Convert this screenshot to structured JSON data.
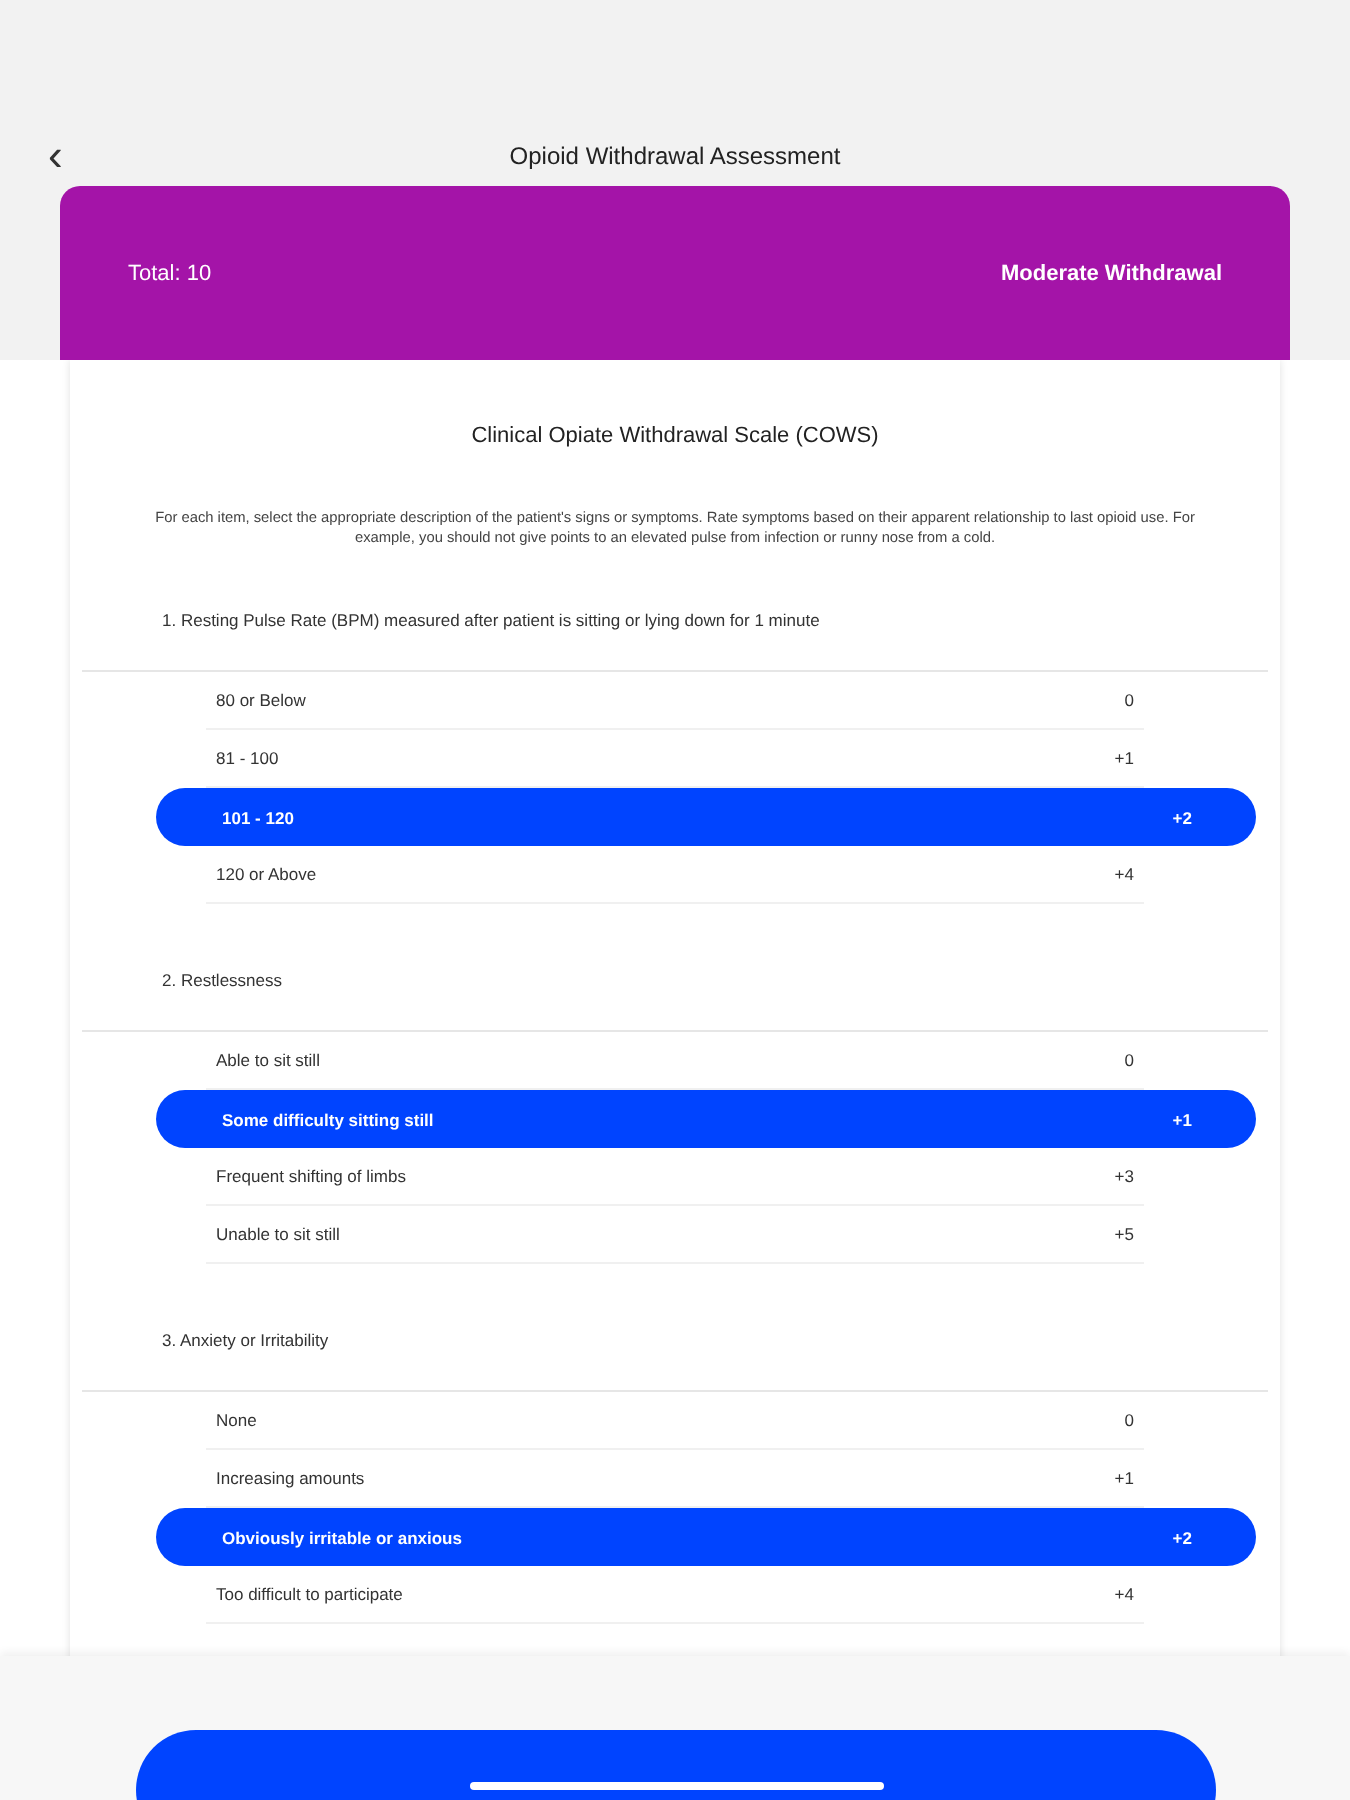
{
  "nav": {
    "back": "‹",
    "title": "Opioid Withdrawal Assessment"
  },
  "summary": {
    "total": "Total: 10",
    "severity": "Moderate Withdrawal"
  },
  "scale_title": "Clinical Opiate Withdrawal Scale (COWS)",
  "instructions": "For each item, select the appropriate description of the patient's signs or symptoms. Rate symptoms based on their apparent relationship to last opioid use. For example, you should not give points to an elevated pulse from infection or runny nose from a cold.",
  "questions": [
    {
      "title": "1. Resting Pulse Rate (BPM) measured after patient is sitting or lying down for 1 minute",
      "options": [
        {
          "label": "80 or Below",
          "points": "0",
          "selected": false
        },
        {
          "label": "81 - 100",
          "points": "+1",
          "selected": false
        },
        {
          "label": "101 - 120",
          "points": "+2",
          "selected": true
        },
        {
          "label": "120 or Above",
          "points": "+4",
          "selected": false
        }
      ]
    },
    {
      "title": "2. Restlessness",
      "options": [
        {
          "label": "Able to sit still",
          "points": "0",
          "selected": false
        },
        {
          "label": "Some difficulty sitting still",
          "points": "+1",
          "selected": true
        },
        {
          "label": "Frequent shifting of limbs",
          "points": "+3",
          "selected": false
        },
        {
          "label": "Unable to sit still",
          "points": "+5",
          "selected": false
        }
      ]
    },
    {
      "title": "3. Anxiety or Irritability",
      "options": [
        {
          "label": "None",
          "points": "0",
          "selected": false
        },
        {
          "label": "Increasing amounts",
          "points": "+1",
          "selected": false
        },
        {
          "label": "Obviously irritable or anxious",
          "points": "+2",
          "selected": true
        },
        {
          "label": "Too difficult to participate",
          "points": "+4",
          "selected": false
        }
      ]
    }
  ]
}
